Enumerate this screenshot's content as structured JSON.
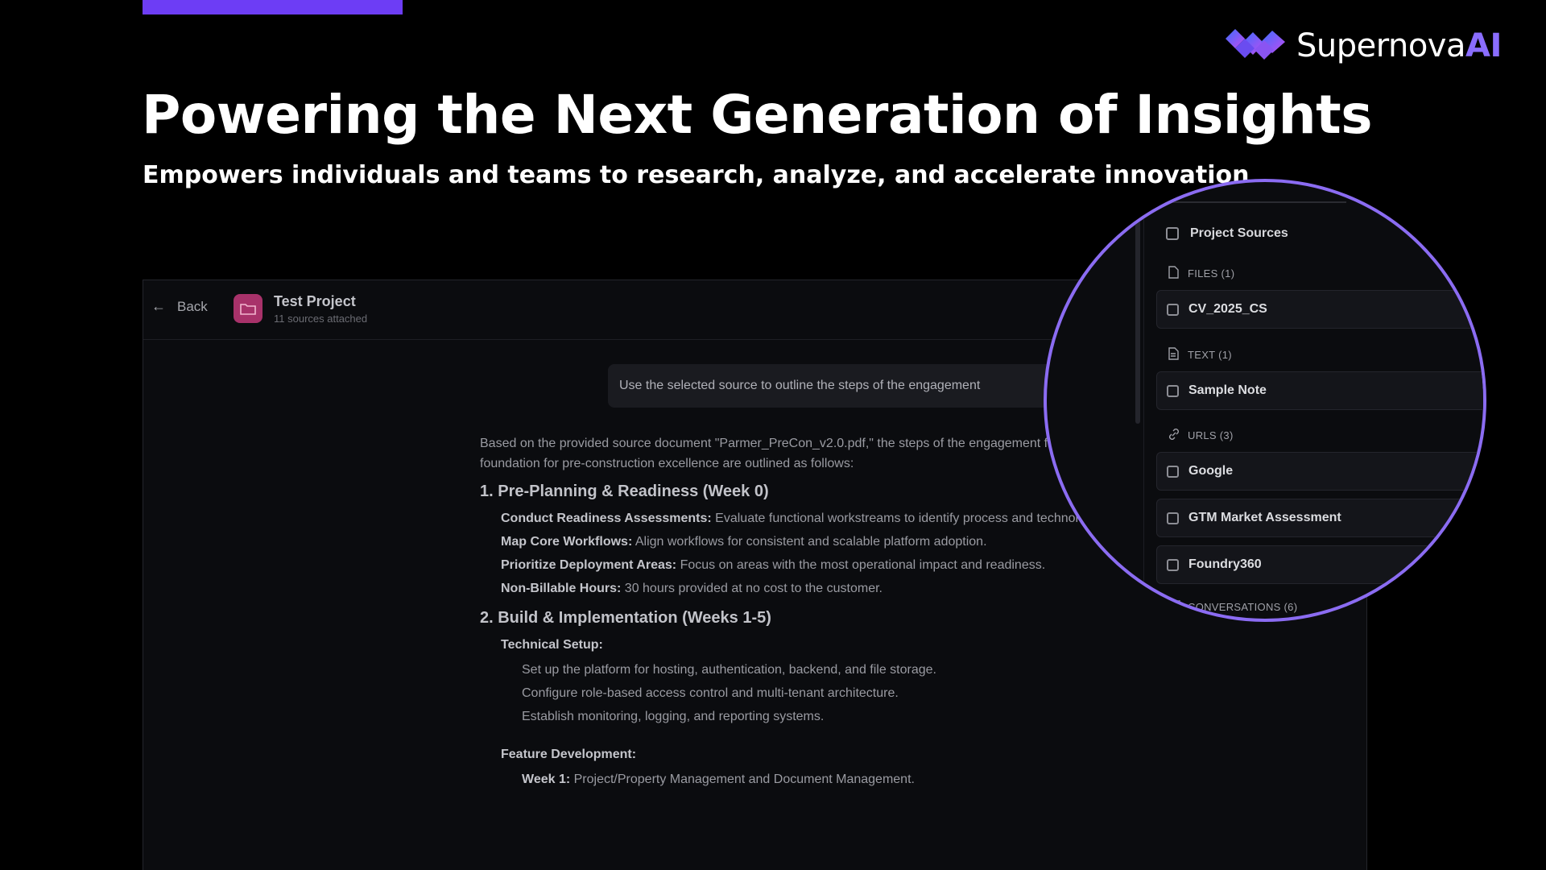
{
  "colors": {
    "accent": "#6d3df5",
    "lens_border": "#8b6cf2",
    "project_icon": "#a8326a"
  },
  "brand": {
    "name_main": "Supernova",
    "name_ai": "AI",
    "logo_icon": "supernova-logo-icon"
  },
  "hero": {
    "title": "Powering the Next Generation of Insights",
    "subtitle": "Empowers individuals and teams to research, analyze, and accelerate innovation"
  },
  "app": {
    "back_label": "Back",
    "project_title": "Test Project",
    "project_subtitle": "11 sources attached",
    "user_message": "Use the selected source to outline the steps of the engagement",
    "answer": {
      "intro": "Based on the provided source document \"Parmer_PreCon_v2.0.pdf,\" the steps of the engagement for laying the digital foundation for pre-construction excellence are outlined as follows:",
      "sections": [
        {
          "heading": "1. Pre-Planning & Readiness (Week 0)",
          "items": [
            {
              "label": "Conduct Readiness Assessments:",
              "text": " Evaluate functional workstreams to identify process and technology gaps."
            },
            {
              "label": "Map Core Workflows:",
              "text": " Align workflows for consistent and scalable platform adoption."
            },
            {
              "label": "Prioritize Deployment Areas:",
              "text": " Focus on areas with the most operational impact and readiness."
            },
            {
              "label": "Non-Billable Hours:",
              "text": " 30 hours provided at no cost to the customer."
            }
          ]
        },
        {
          "heading": "2. Build & Implementation (Weeks 1-5)",
          "technical_setup": {
            "label": "Technical Setup:",
            "items": [
              "Set up the platform for hosting, authentication, backend, and file storage.",
              "Configure role-based access control and multi-tenant architecture.",
              "Establish monitoring, logging, and reporting systems."
            ]
          },
          "feature_development": {
            "label": "Feature Development:",
            "week1_label": "Week 1:",
            "week1_text": " Project/Property Management and Document Management."
          }
        }
      ]
    }
  },
  "sources_panel": {
    "title": "Project Sources",
    "files": {
      "heading": "FILES (1)",
      "items": [
        "CV_2025_CS"
      ]
    },
    "text": {
      "heading": "TEXT (1)",
      "items": [
        "Sample Note"
      ]
    },
    "urls": {
      "heading": "URLS (3)",
      "items": [
        "Google",
        "GTM Market Assessment",
        "Foundry360"
      ]
    },
    "conversations": {
      "heading": "CONVERSATIONS (6)"
    }
  }
}
